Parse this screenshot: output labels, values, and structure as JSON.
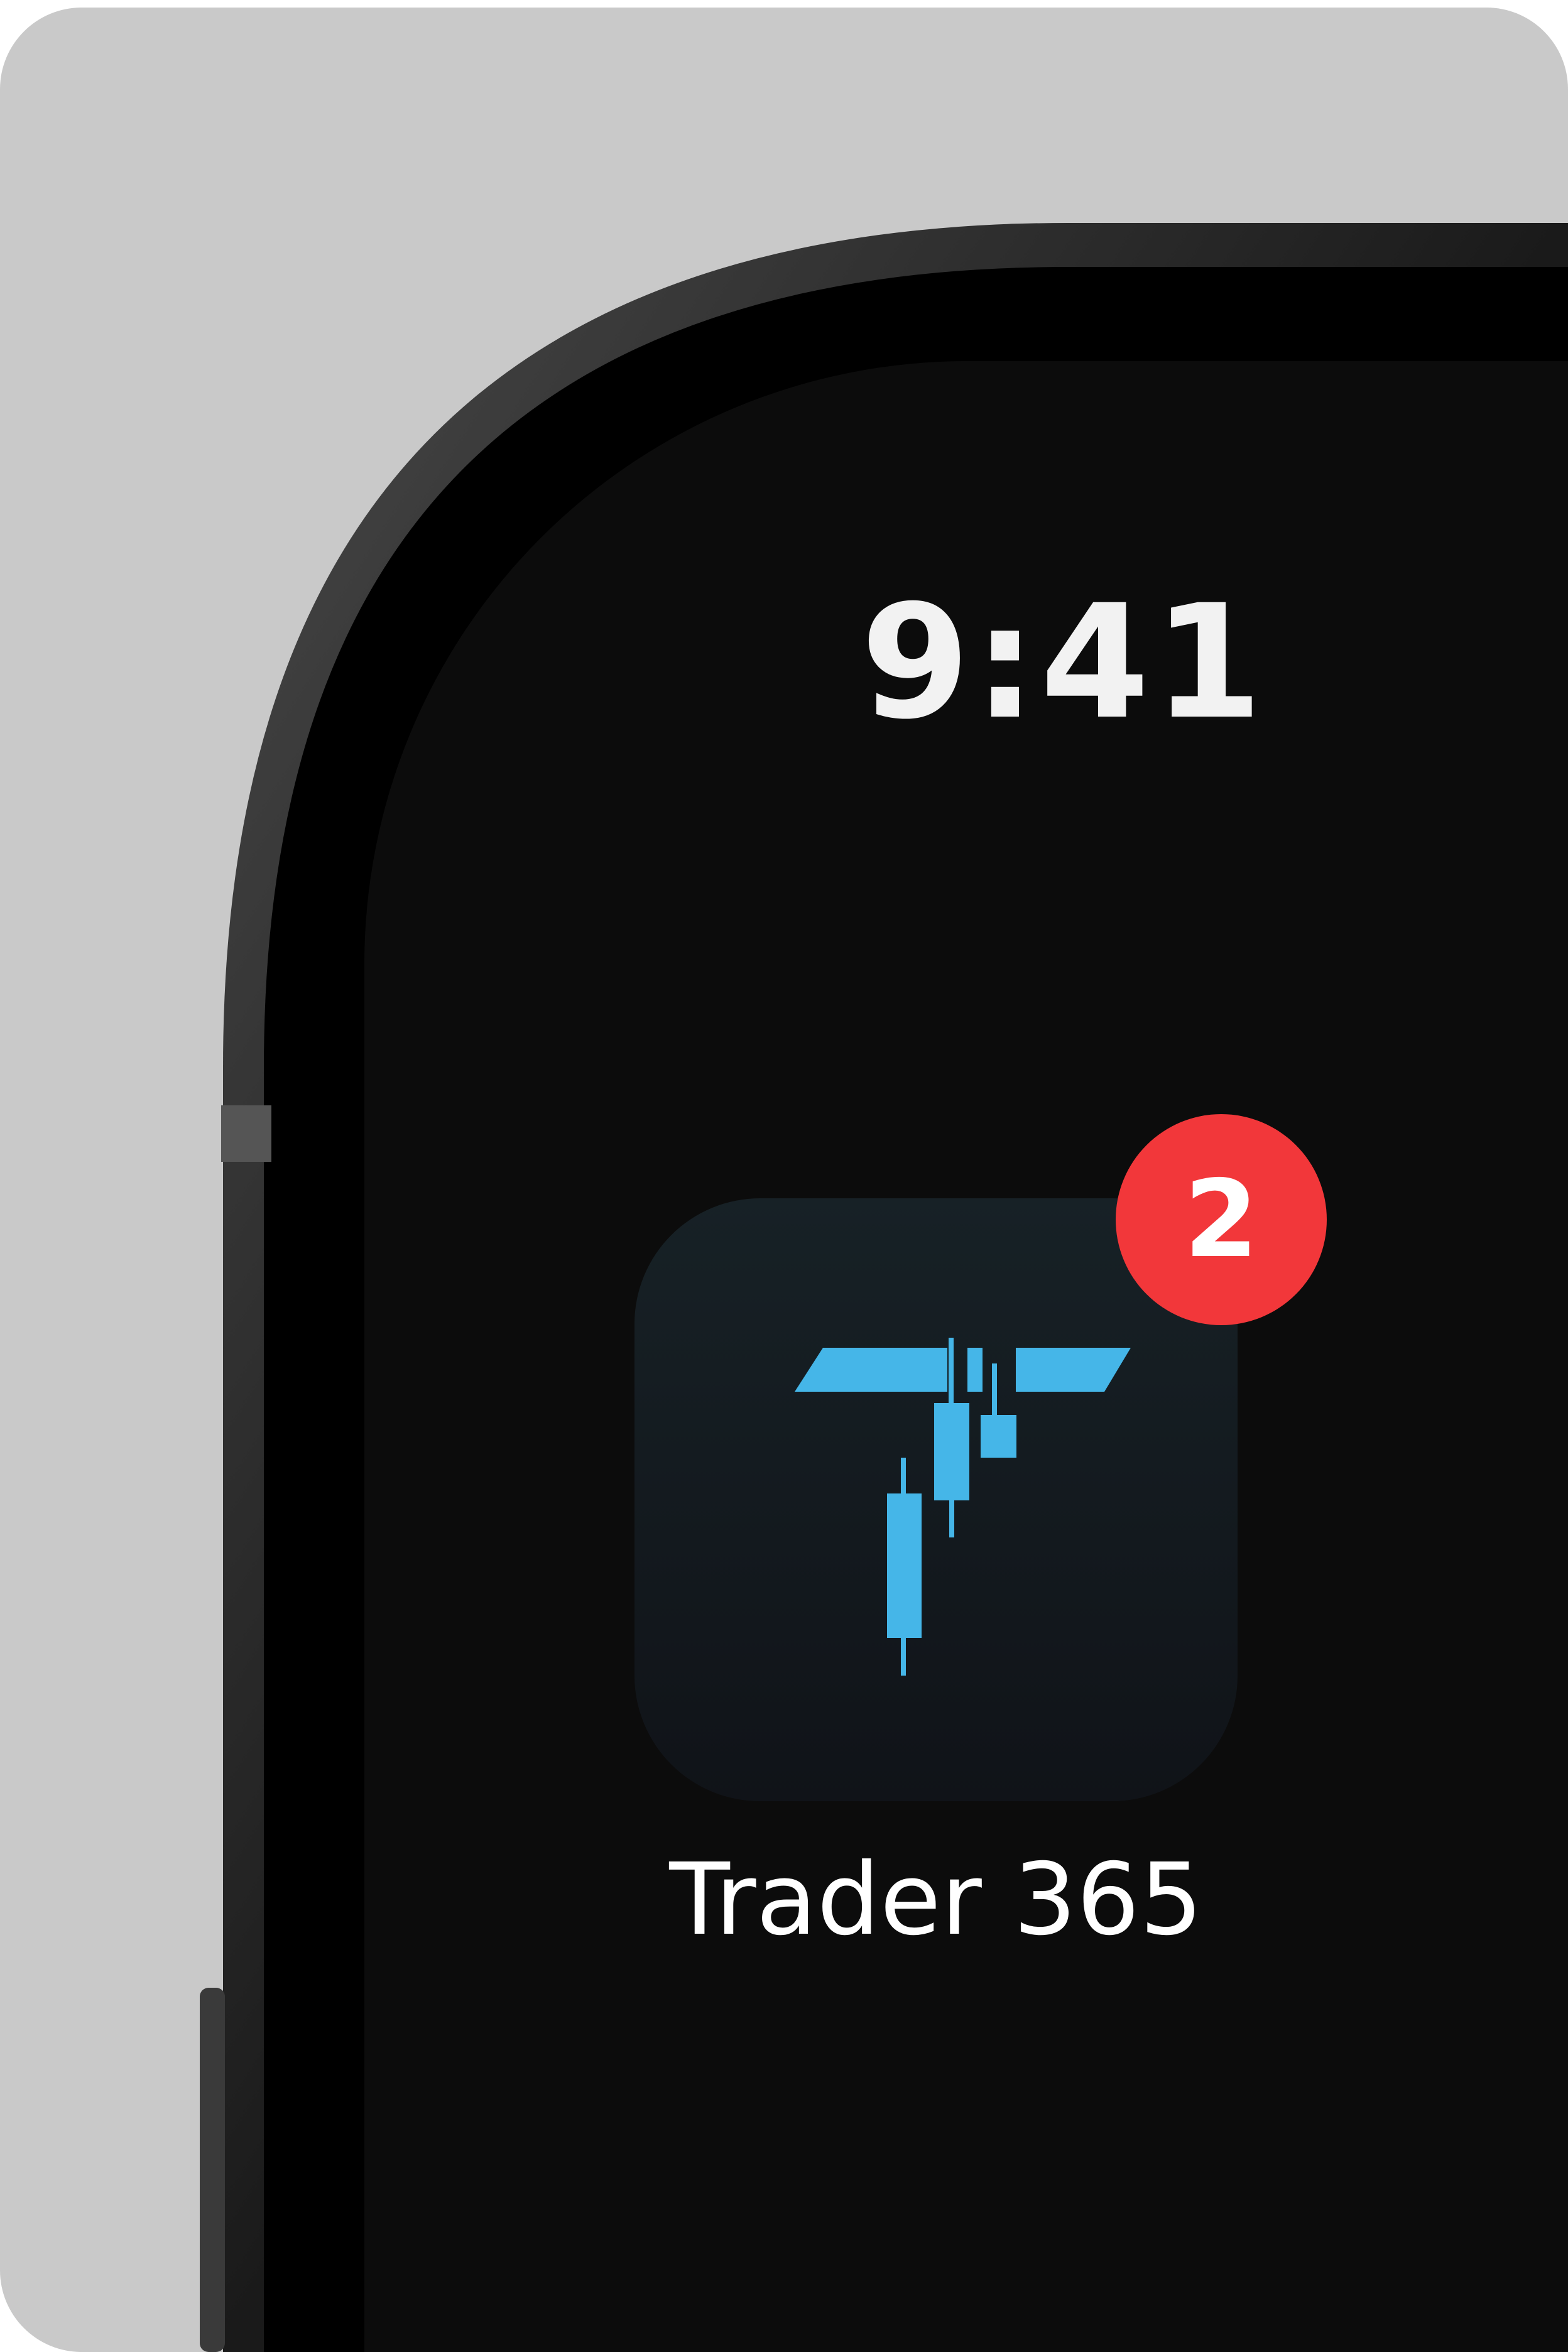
{
  "status_bar": {
    "time": "9:41"
  },
  "home_screen": {
    "apps": [
      {
        "label": "Trader 365",
        "icon": "trader-365-candlestick-t-logo",
        "badge_count": "2"
      }
    ]
  },
  "colors": {
    "background": "#c9c9c9",
    "screen": "#0c0c0c",
    "icon_accent": "#45b6e8",
    "badge": "#f2373a"
  }
}
